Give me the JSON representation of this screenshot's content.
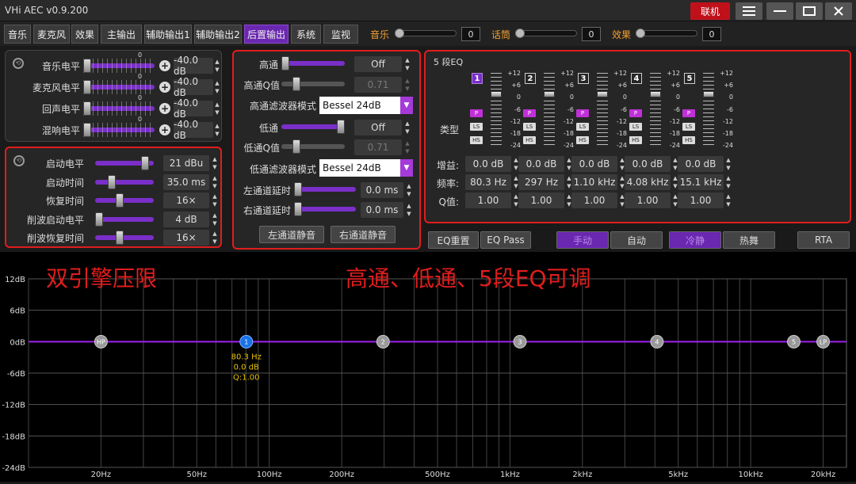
{
  "app": {
    "title": "VHi AEC v0.9.200",
    "connect_label": "联机"
  },
  "tabs": [
    "音乐",
    "麦克风",
    "效果",
    "主输出",
    "辅助输出1",
    "辅助输出2",
    "后置输出",
    "系统",
    "监视"
  ],
  "header_sliders": [
    {
      "label": "音乐",
      "value": "0"
    },
    {
      "label": "话筒",
      "value": "0"
    },
    {
      "label": "效果",
      "value": "0"
    }
  ],
  "levels": {
    "rows": [
      {
        "label": "音乐电平",
        "value": "-40.0 dB"
      },
      {
        "label": "麦克风电平",
        "value": "-40.0 dB"
      },
      {
        "label": "回声电平",
        "value": "-40.0 dB"
      },
      {
        "label": "混响电平",
        "value": "-40.0 dB"
      }
    ],
    "scale_zero": "0"
  },
  "limiter": {
    "rows": [
      {
        "label": "启动电平",
        "value": "21 dBu"
      },
      {
        "label": "启动时间",
        "value": "35.0 ms"
      },
      {
        "label": "恢复时间",
        "value": "16×"
      },
      {
        "label": "削波启动电平",
        "value": "4 dB"
      },
      {
        "label": "削波恢复时间",
        "value": "16×"
      }
    ]
  },
  "filters": {
    "highpass_label": "高通",
    "highpass_value": "Off",
    "highq_label": "高通Q值",
    "highq_value": "0.71",
    "hp_mode_label": "高通滤波器模式",
    "hp_mode_value": "Bessel 24dB",
    "lowpass_label": "低通",
    "lowpass_value": "Off",
    "lowq_label": "低通Q值",
    "lowq_value": "0.71",
    "lp_mode_label": "低通滤波器模式",
    "lp_mode_value": "Bessel 24dB",
    "left_delay_label": "左通道延时",
    "left_delay_value": "0.0 ms",
    "right_delay_label": "右通道延时",
    "right_delay_value": "0.0 ms",
    "left_mute": "左通道静音",
    "right_mute": "右通道静音"
  },
  "eq": {
    "title": "5 段EQ",
    "type_label": "类型",
    "scale": [
      "+12",
      "+6",
      "0",
      "-6",
      "-12",
      "-18",
      "-24"
    ],
    "bands": [
      {
        "num": "1",
        "gain": "0.0 dB",
        "freq": "80.3 Hz",
        "q": "1.00"
      },
      {
        "num": "2",
        "gain": "0.0 dB",
        "freq": "297 Hz",
        "q": "1.00"
      },
      {
        "num": "3",
        "gain": "0.0 dB",
        "freq": "1.10 kHz",
        "q": "1.00"
      },
      {
        "num": "4",
        "gain": "0.0 dB",
        "freq": "4.08 kHz",
        "q": "1.00"
      },
      {
        "num": "5",
        "gain": "0.0 dB",
        "freq": "15.1 kHz",
        "q": "1.00"
      }
    ],
    "type_buttons": [
      "P",
      "LS",
      "HS"
    ],
    "gain_label": "增益:",
    "freq_label": "频率:",
    "q_label": "Q值:"
  },
  "bottom_buttons": {
    "eq_reset": "EQ重置",
    "eq_pass": "EQ Pass",
    "manual": "手动",
    "auto": "自动",
    "cold": "冷静",
    "hot": "热舞",
    "rta": "RTA"
  },
  "overlay": {
    "left": "双引擎压限",
    "right": "高通、低通、5段EQ可调"
  },
  "graph": {
    "y_labels": [
      "12dB",
      "6dB",
      "0dB",
      "-6dB",
      "-12dB",
      "-18dB",
      "-24dB"
    ],
    "x_labels": [
      "20Hz",
      "50Hz",
      "100Hz",
      "200Hz",
      "500Hz",
      "1kHz",
      "2kHz",
      "5kHz",
      "10kHz",
      "20kHz"
    ],
    "points": [
      {
        "label": "HP",
        "freq": 20,
        "gain": 0
      },
      {
        "label": "1",
        "freq": 80.3,
        "gain": 0
      },
      {
        "label": "2",
        "freq": 297,
        "gain": 0
      },
      {
        "label": "3",
        "freq": 1100,
        "gain": 0
      },
      {
        "label": "4",
        "freq": 4080,
        "gain": 0
      },
      {
        "label": "5",
        "freq": 15100,
        "gain": 0
      },
      {
        "label": "LP",
        "freq": 20000,
        "gain": 0
      }
    ],
    "selected_info": {
      "freq": "80.3 Hz",
      "gain": "0.0 dB",
      "q": "Q:1.00"
    }
  }
}
